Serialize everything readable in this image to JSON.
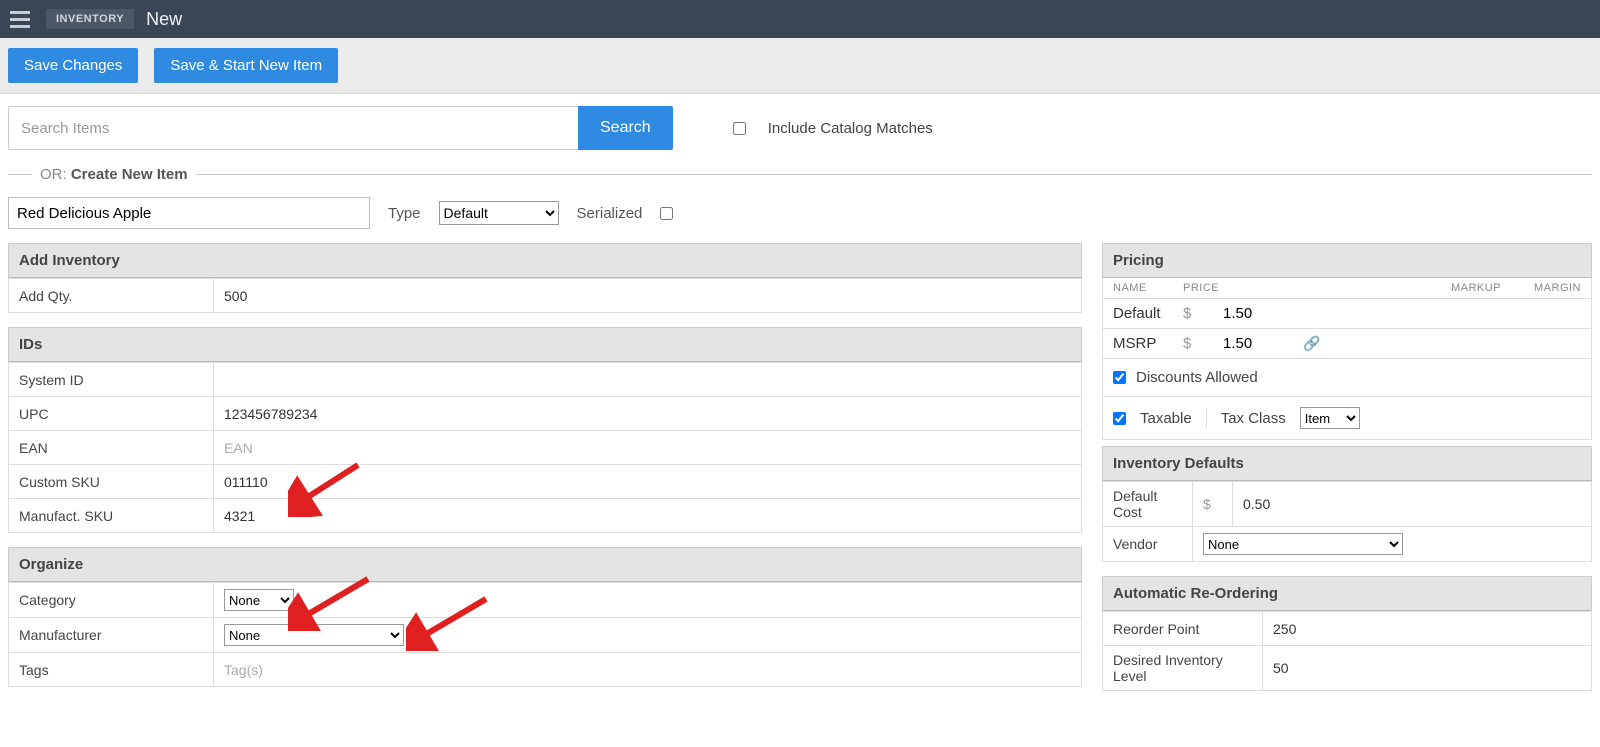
{
  "header": {
    "section": "Inventory",
    "title": "New"
  },
  "actions": {
    "save": "Save Changes",
    "save_new": "Save & Start New Item"
  },
  "search": {
    "placeholder": "Search Items",
    "button": "Search",
    "include_label": "Include Catalog Matches"
  },
  "divider": {
    "prefix": "OR:",
    "label": "Create New Item"
  },
  "new_item": {
    "name_value": "Red Delicious Apple",
    "type_label": "Type",
    "type_value": "Default",
    "serialized_label": "Serialized"
  },
  "add_inventory": {
    "header": "Add Inventory",
    "qty_label": "Add Qty.",
    "qty_value": "500"
  },
  "ids": {
    "header": "IDs",
    "system_id_label": "System ID",
    "system_id_value": "",
    "upc_label": "UPC",
    "upc_value": "123456789234",
    "ean_label": "EAN",
    "ean_placeholder": "EAN",
    "ean_value": "",
    "custom_sku_label": "Custom SKU",
    "custom_sku_value": "011110",
    "mfr_sku_label": "Manufact. SKU",
    "mfr_sku_value": "4321"
  },
  "organize": {
    "header": "Organize",
    "category_label": "Category",
    "category_value": "None",
    "manufacturer_label": "Manufacturer",
    "manufacturer_value": "None",
    "tags_label": "Tags",
    "tags_placeholder": "Tag(s)"
  },
  "pricing": {
    "header": "Pricing",
    "col_name": "NAME",
    "col_price": "PRICE",
    "col_markup": "MARKUP",
    "col_margin": "MARGIN",
    "currency": "$",
    "rows": [
      {
        "name": "Default",
        "price": "1.50"
      },
      {
        "name": "MSRP",
        "price": "1.50"
      }
    ],
    "discounts_label": "Discounts Allowed",
    "taxable_label": "Taxable",
    "tax_class_label": "Tax Class",
    "tax_class_value": "Item"
  },
  "inv_defaults": {
    "header": "Inventory Defaults",
    "default_cost_label": "Default Cost",
    "currency": "$",
    "default_cost_value": "0.50",
    "vendor_label": "Vendor",
    "vendor_value": "None"
  },
  "reorder": {
    "header": "Automatic Re-Ordering",
    "point_label": "Reorder Point",
    "point_value": "250",
    "desired_label": "Desired Inventory Level",
    "desired_value": "50"
  }
}
